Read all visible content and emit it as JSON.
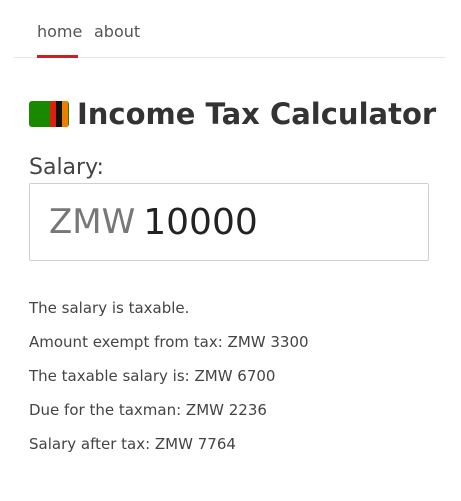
{
  "nav": {
    "home_label": "home",
    "about_label": "about"
  },
  "header": {
    "flag_icon": "zambia-flag-icon",
    "title": "Income Tax Calculator"
  },
  "form": {
    "salary_label": "Salary:",
    "currency": "ZMW",
    "salary_value": "10000"
  },
  "results": [
    "The salary is taxable.",
    "Amount exempt from tax: ZMW 3300",
    "The taxable salary is: ZMW 6700",
    "Due for the taxman: ZMW 2236",
    "Salary after tax: ZMW 7764"
  ],
  "colors": {
    "accent": "#cc1f1f",
    "flag_green": "#198a00",
    "flag_red": "#de2010",
    "flag_black": "#111111",
    "flag_orange": "#ef7d00"
  }
}
